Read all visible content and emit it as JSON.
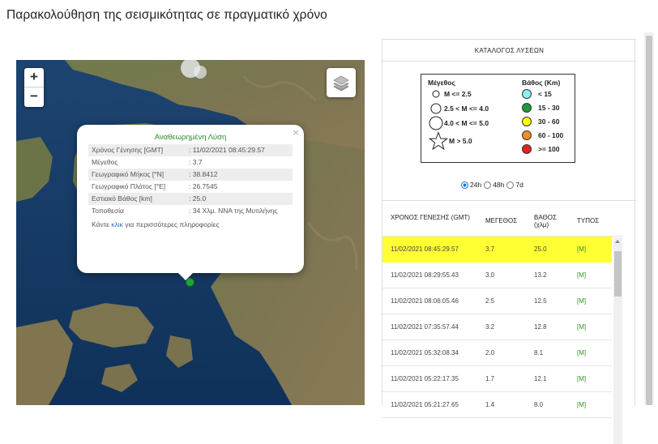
{
  "page": {
    "title": "Παρακολούθηση της σεισμικότητας σε πραγματικό χρόνο"
  },
  "map": {
    "zoom_in": "+",
    "zoom_out": "−",
    "layers_icon": "layers-icon",
    "popup": {
      "heading": "Αναθεωρημένη Λύση",
      "close": "×",
      "rows": [
        {
          "key": "Χρόνος Γένησης [GMT]",
          "value": ": 11/02/2021 08:45:29.57"
        },
        {
          "key": "Μέγεθος",
          "value": ": 3.7"
        },
        {
          "key": "Γεωγραφικό Μήκος [°N]",
          "value": ": 38.8412"
        },
        {
          "key": "Γεωγραφικό Πλάτος [°E]",
          "value": ": 26.7545"
        },
        {
          "key": "Εστιακό Βάθος [km]",
          "value": ": 25.0"
        },
        {
          "key": "Τοποθεσία",
          "value": ": 34 Χλμ. ΝΝΑ της Μυτιλήνης"
        }
      ],
      "footer_before": "Κάντε ",
      "footer_link": "κλικ",
      "footer_after": " για περισσότερες πληροφορίες"
    }
  },
  "panel": {
    "title": "ΚΑΤΑΛΟΓΟΣ ΛΥΣΕΩΝ",
    "legend": {
      "magnitude_title": "Μέγεθος",
      "magnitude_items": [
        "M <= 2.5",
        "2.5 < M <= 4.0",
        "4.0 < M <= 5.0",
        "M > 5.0"
      ],
      "depth_title": "Βάθος (Km)",
      "depth_items": [
        {
          "label": "< 15",
          "color": "#8ff0f0"
        },
        {
          "label": "15 - 30",
          "color": "#1f9a3a"
        },
        {
          "label": "30 - 60",
          "color": "#ffff00"
        },
        {
          "label": "60 - 100",
          "color": "#f28c28"
        },
        {
          "label": ">= 100",
          "color": "#e82020"
        }
      ]
    },
    "range_options": [
      "24h",
      "48h",
      "7d"
    ],
    "range_selected": "24h",
    "table": {
      "headers": {
        "time": "ΧΡΟΝΟΣ ΓΕΝΕΣΗΣ (GMT)",
        "mag": "ΜΕΓΕΘΟΣ",
        "depth": "ΒΑΘΟΣ (χλμ)",
        "type": "ΤΥΠΟΣ"
      },
      "rows": [
        {
          "time": "11/02/2021 08:45:29.57",
          "mag": "3.7",
          "depth": "25.0",
          "type": "[M]"
        },
        {
          "time": "11/02/2021 08:29:55.43",
          "mag": "3.0",
          "depth": "13.2",
          "type": "[M]"
        },
        {
          "time": "11/02/2021 08:06:05.46",
          "mag": "2.5",
          "depth": "12.5",
          "type": "[M]"
        },
        {
          "time": "11/02/2021 07:35:57.44",
          "mag": "3.2",
          "depth": "12.8",
          "type": "[M]"
        },
        {
          "time": "11/02/2021 05:32:08.34",
          "mag": "2.0",
          "depth": "8.1",
          "type": "[M]"
        },
        {
          "time": "11/02/2021 05:22:17.35",
          "mag": "1.7",
          "depth": "12.1",
          "type": "[M]"
        },
        {
          "time": "11/02/2021 05:21:27.65",
          "mag": "1.4",
          "depth": "8.0",
          "type": "[M]"
        }
      ]
    }
  }
}
